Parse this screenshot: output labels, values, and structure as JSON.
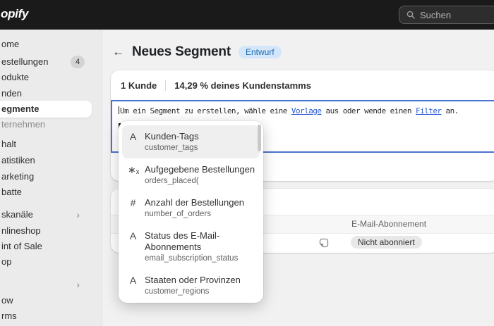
{
  "topbar": {
    "logo_text": "opify",
    "search_placeholder": "Suchen"
  },
  "sidebar": {
    "items": [
      {
        "label": "ome"
      },
      {
        "label": "estellungen",
        "badge": "4"
      },
      {
        "label": "odukte"
      },
      {
        "label": "nden"
      },
      {
        "label": "egmente",
        "selected": true
      },
      {
        "label": "ternehmen",
        "muted": true
      },
      {
        "label": "halt"
      },
      {
        "label": "atistiken"
      },
      {
        "label": "arketing"
      },
      {
        "label": "batte"
      },
      {
        "label": "skanäle",
        "has_chevron": true
      },
      {
        "label": "nlineshop"
      },
      {
        "label": "int of Sale"
      },
      {
        "label": "op"
      },
      {
        "label": "",
        "has_chevron": true
      },
      {
        "label": "ow"
      },
      {
        "label": "rms"
      }
    ]
  },
  "header": {
    "back_icon": "←",
    "title": "Neues Segment",
    "status_badge": "Entwurf"
  },
  "summary": {
    "customer_count": "1 Kunde",
    "percent_of_base": "14,29 % deines Kundenstamms"
  },
  "editor": {
    "hint_part1": "Um ein Segment zu erstellen, wähle eine ",
    "link_vorlage": "Vorlage",
    "hint_part2": " aus oder wende einen ",
    "link_filter": "Filter",
    "hint_part3": " an."
  },
  "filter_dropdown": {
    "items": [
      {
        "icon": "A",
        "label": "Kunden-Tags",
        "code": "customer_tags",
        "selected": true
      },
      {
        "icon": "∗ₓ",
        "label": "Aufgegebene Bestellungen",
        "code": "orders_placed("
      },
      {
        "icon": "#",
        "label": "Anzahl der Bestellungen",
        "code": "number_of_orders"
      },
      {
        "icon": "A",
        "label": "Status des E-Mail-Abonnements",
        "code": "email_subscription_status"
      },
      {
        "icon": "A",
        "label": "Staaten oder Provinzen",
        "code": "customer_regions"
      }
    ]
  },
  "customers_table": {
    "email_column_header": "E-Mail-Abonnement",
    "email_status_badge": "Nicht abonniert"
  },
  "icons": {
    "chevron_right": "›"
  },
  "colors": {
    "topbar_bg": "#1a1a1a",
    "sidebar_bg": "#ebebeb",
    "page_bg": "#f1f1f1",
    "accent_link": "#2a5ad4",
    "editor_focus_border": "#4a73cf",
    "draft_badge_bg": "#d3e6fa",
    "draft_badge_text": "#1c6db2",
    "neutral_badge_bg": "#e8e8e8"
  }
}
